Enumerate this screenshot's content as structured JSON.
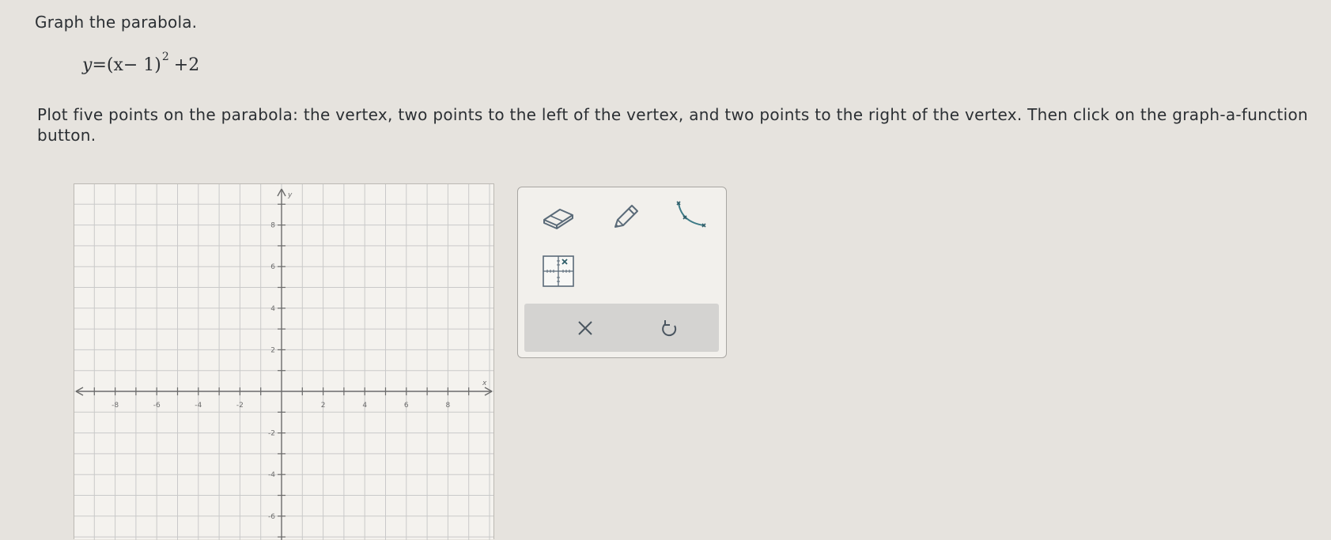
{
  "prompt": "Graph the parabola.",
  "equation": {
    "lhs": "y",
    "eq": "=",
    "base": "(x− 1)",
    "exponent": "2",
    "tail": "+2"
  },
  "instructions": "Plot five points on the parabola: the vertex, two points to the left of the vertex, and two points to the right of the vertex. Then click on the graph-a-function button.",
  "graph": {
    "x_axis_label": "x",
    "y_axis_label": "y",
    "x_tick_labels": [
      "-8",
      "-6",
      "-4",
      "-2",
      "2",
      "4",
      "6",
      "8"
    ],
    "y_tick_labels": [
      "8",
      "6",
      "4",
      "2",
      "-2",
      "-4",
      "-6"
    ],
    "grid": true
  },
  "toolbar": {
    "tools": [
      {
        "name": "eraser",
        "icon": "eraser-icon"
      },
      {
        "name": "pencil",
        "icon": "pencil-icon"
      },
      {
        "name": "curve",
        "icon": "parabola-tool-icon"
      },
      {
        "name": "graph-a-function",
        "icon": "graph-function-icon"
      }
    ],
    "clear_icon": "close-icon",
    "undo_icon": "undo-icon"
  },
  "colors": {
    "background": "#e6e3de",
    "grid_line": "#c9c9c9",
    "axis": "#6b6b6b",
    "icon": "#5a6a78",
    "curve_tool": "#3d7a86"
  }
}
